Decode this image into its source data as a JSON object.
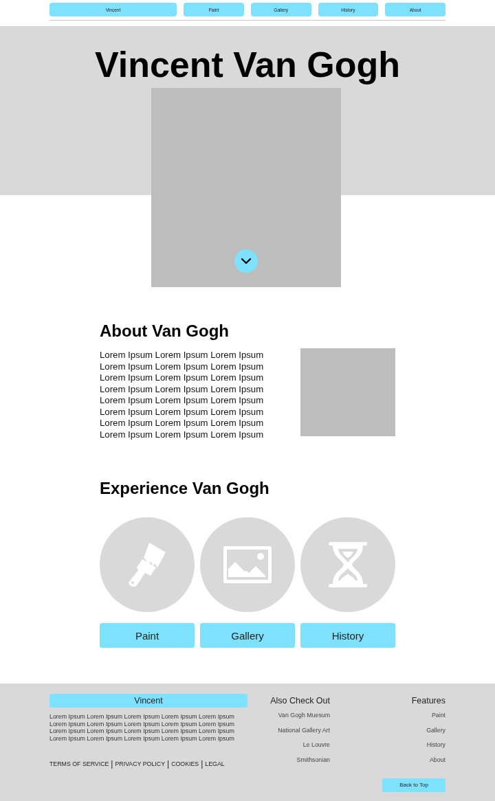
{
  "nav": [
    "Vincent",
    "Paint",
    "Gallery",
    "History",
    "About"
  ],
  "hero": {
    "title": "Vincent Van Gogh"
  },
  "about": {
    "heading": "About Van Gogh",
    "lines": [
      "Lorem Ipsum Lorem Ipsum Lorem Ipsum",
      "Lorem Ipsum Lorem Ipsum Lorem Ipsum",
      "Lorem Ipsum Lorem Ipsum Lorem Ipsum",
      "Lorem Ipsum Lorem Ipsum Lorem Ipsum",
      "Lorem Ipsum Lorem Ipsum Lorem Ipsum",
      "Lorem Ipsum Lorem Ipsum Lorem Ipsum",
      "Lorem Ipsum Lorem Ipsum Lorem Ipsum",
      "Lorem Ipsum Lorem Ipsum Lorem Ipsum"
    ]
  },
  "experience": {
    "heading": "Experience Van Gogh",
    "buttons": [
      "Paint",
      "Gallery",
      "History"
    ]
  },
  "footer": {
    "brand": "Vincent",
    "lines": [
      "Lorem Ipsum Lorem Ipsum Lorem Ipsum Lorem Ipsum Lorem Ipsum",
      "Lorem Ipsum Lorem Ipsum Lorem Ipsum Lorem Ipsum Lorem Ipsum",
      "Lorem Ipsum Lorem Ipsum Lorem Ipsum Lorem Ipsum Lorem Ipsum",
      "Lorem Ipsum Lorem Ipsum Lorem Ipsum Lorem Ipsum Lorem Ipsum"
    ],
    "legal_links": [
      "TERMS OF SERVICE",
      "PRIVACY POLICY",
      "COOKIES",
      "LEGAL"
    ],
    "separator": "|",
    "columns": [
      {
        "heading": "Also Check Out",
        "links": [
          "Van Gogh Muesum",
          "National Gallery Art",
          "Le Louvre",
          "Smithsonian"
        ]
      },
      {
        "heading": "Features",
        "links": [
          "Paint",
          "Gallery",
          "History",
          "About"
        ]
      }
    ],
    "back_to_top": "Back to Top"
  }
}
